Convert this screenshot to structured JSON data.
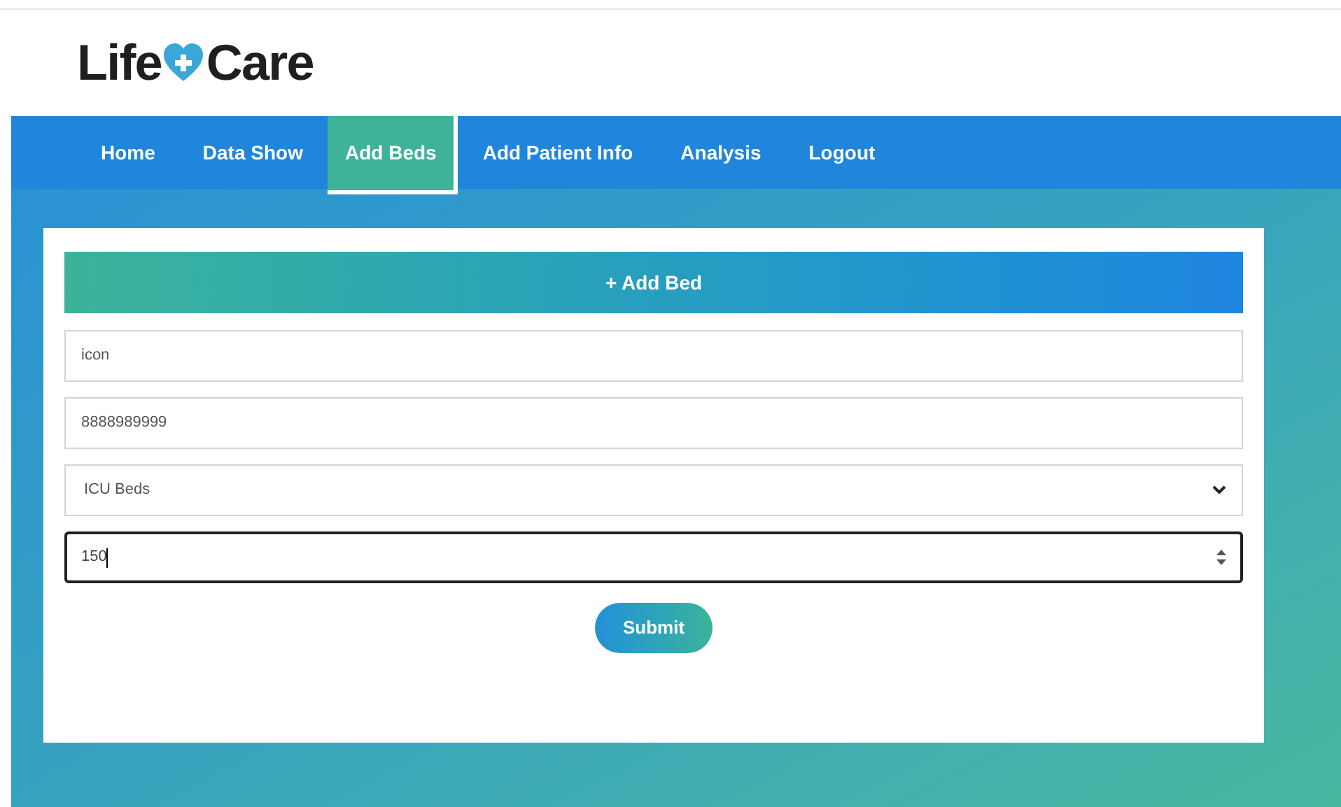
{
  "logo": {
    "left": "Life",
    "right": "Care"
  },
  "nav": [
    {
      "label": "Home",
      "selected": false
    },
    {
      "label": "Data Show",
      "selected": false
    },
    {
      "label": "Add Beds",
      "selected": true
    },
    {
      "label": "Add Patient Info",
      "selected": false
    },
    {
      "label": "Analysis",
      "selected": false
    },
    {
      "label": "Logout",
      "selected": false
    }
  ],
  "form": {
    "title": "+ Add Bed",
    "fields": [
      {
        "kind": "text",
        "value": "icon",
        "focused": false
      },
      {
        "kind": "text",
        "value": "8888989999",
        "focused": false
      },
      {
        "kind": "select",
        "value": "ICU Beds",
        "focused": false
      },
      {
        "kind": "number",
        "value": "150",
        "focused": true
      }
    ],
    "submit": "Submit"
  }
}
